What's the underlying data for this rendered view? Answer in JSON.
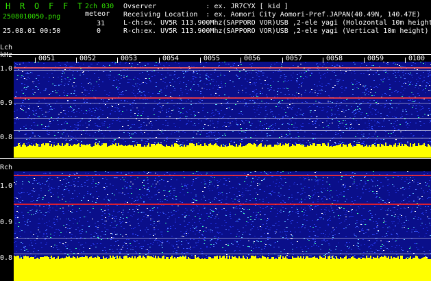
{
  "header": {
    "brand_letters": [
      "H",
      "R",
      "O",
      "F",
      "F",
      "T"
    ],
    "file_name": "2508010050.png",
    "timestamp": "25.08.01 00:50",
    "mode": "2ch 030",
    "meteor_label": "meteor",
    "meteor_count_l": "31",
    "meteor_count_r": "0",
    "observer": "Ovserver            : ex. JR7CYX [ kid ]",
    "location": "Receiving Location  : ex. Aomori City Aomori-Pref.JAPAN(40.49N, 140.47E)",
    "lch_desc": "L-ch:ex. UV5R 113.900Mhz(SAPPORO VOR)USB ,2-ele yagi (Holozontal 10m height)",
    "rch_desc": "R-ch:ex. UV5R 113.900Mhz(SAPPORO VOR)USB ,2-ele yagi (Vertical 10m height)"
  },
  "lch": {
    "label": "Lch",
    "unit": "kHz",
    "yticks": [
      "1.0",
      "0.9",
      "0.8"
    ]
  },
  "rch": {
    "label": "Rch",
    "yticks": [
      "1.0",
      "0.9",
      "0.8"
    ]
  },
  "time_ticks": [
    "0051",
    "0052",
    "0053",
    "0054",
    "0055",
    "0056",
    "0057",
    "0058",
    "0059",
    "0100"
  ],
  "colors": {
    "text_green": "#31e000",
    "amplitude_yellow": "#ffff00",
    "noise_blue": "#1018c0"
  }
}
